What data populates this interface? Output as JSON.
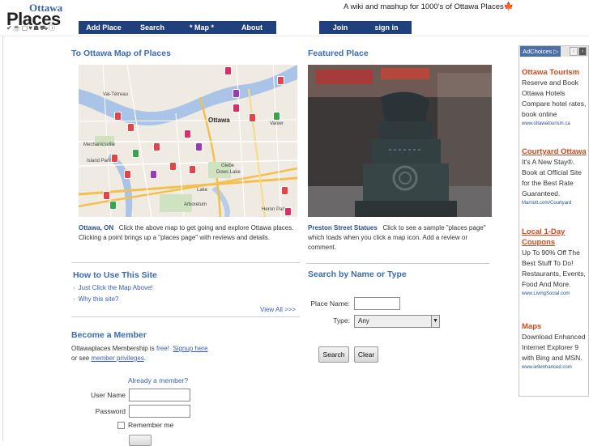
{
  "logo": {
    "top": "Ottawa",
    "main": "Places",
    "icons": [
      "✔",
      "☕",
      "▢",
      "♥",
      "☗",
      "⛟",
      "ⓘ"
    ]
  },
  "tagline": "A wiki and mashup for 1000's of Ottawa Places",
  "nav": {
    "left": [
      "Add Place",
      "Search",
      "* Map *",
      "About"
    ],
    "right": [
      "Join",
      "sign in"
    ]
  },
  "map_section": {
    "title": "To Ottawa Map of Places",
    "caption_bold": "Ottawa, ON",
    "caption": "Click the above map to get going and explore Ottawa places. Clicking a point brings up a \"places page\" with reviews and details.",
    "labels": [
      "Val-Tétreau",
      "Ottawa",
      "Vanier",
      "Mechanicsville",
      "Island Park",
      "Glebe",
      "Dows Lake",
      "Lake",
      "Arboretum",
      "Heron Park"
    ]
  },
  "featured": {
    "title": "Featured Place",
    "caption_bold": "Preston Street Statues",
    "caption": "Click to see a sample \"places page\" which loads when you click a map icon. Add a review or comment."
  },
  "howto": {
    "title": "How to Use This Site",
    "items": [
      "Just Click the Map Above!",
      "Why this site?"
    ],
    "view_all": "View All >>>"
  },
  "member": {
    "title": "Become a Member",
    "text_pre": "Ottawaplaces Membership is ",
    "free": "free!",
    "signup": "Signup here",
    "text_or": "or see ",
    "privileges": "member privileges",
    "period": ".",
    "already": "Already a member?",
    "username_label": "User Name",
    "password_label": "Password",
    "remember": "Remember me"
  },
  "search": {
    "title": "Search by Name or Type",
    "name_label": "Place Name:",
    "type_label": "Type:",
    "type_value": "Any",
    "search_button": "Search",
    "clear_button": "Clear"
  },
  "ads": {
    "adchoices": "AdChoices",
    "items": [
      {
        "title": "Ottawa Tourism",
        "body": "Reserve and Book Ottawa Hotels Compare hotel rates, book online",
        "url": "www.ottawatourism.ca"
      },
      {
        "title": "Courtyard Ottawa",
        "body": "It's A New Stay®. Book at Official Site for the Best Rate Guaranteed.",
        "url": "Marriott.com/Courtyard"
      },
      {
        "title": "Local 1-Day Coupons",
        "body": "Up To 90% Off The Best Stuff To Do! Restaurants, Events, Food And More.",
        "url": "www.LivingSocial.com"
      },
      {
        "title": "Maps",
        "body": "Download Enhanced Internet Explorer 9 with Bing and MSN.",
        "url": "www.ie9enhanced.com"
      }
    ]
  }
}
